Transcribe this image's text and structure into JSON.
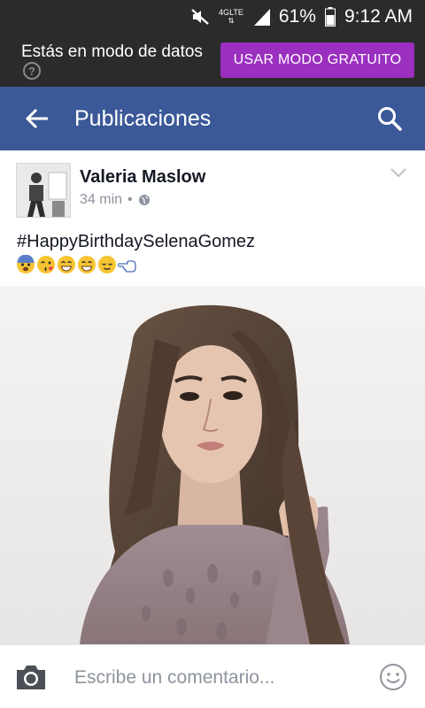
{
  "status_bar": {
    "network": "4G",
    "network_sub": "LTE",
    "battery_percent": "61%",
    "time": "9:12 AM",
    "icons": [
      "mute-icon",
      "network-4g-icon",
      "signal-icon",
      "battery-icon"
    ]
  },
  "banner": {
    "message": "Estás en modo de datos",
    "button_label": "USAR MODO GRATUITO",
    "accent": "#9b2fbf"
  },
  "app_bar": {
    "title": "Publicaciones",
    "color": "#3b5998"
  },
  "post": {
    "author": "Valeria Maslow",
    "time": "34 min",
    "separator": "•",
    "text": "#HappyBirthdaySelenaGomez",
    "emojis": [
      "fearful-face",
      "face-blowing-kiss",
      "grinning-face",
      "grinning-face",
      "relieved-face",
      "pointing-left-hand"
    ]
  },
  "comment_bar": {
    "placeholder": "Escribe un comentario..."
  }
}
